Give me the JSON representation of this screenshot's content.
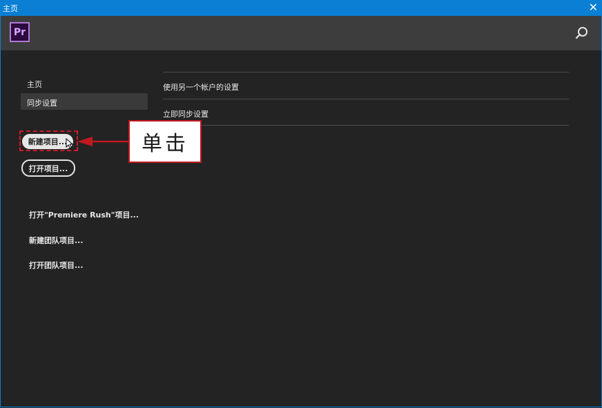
{
  "window": {
    "title": "主页",
    "close_symbol": "✕"
  },
  "header": {
    "logo_text": "Pr",
    "search_icon": "search-icon"
  },
  "sidebar": {
    "home_label": "主页",
    "sync_label": "同步设置"
  },
  "buttons": {
    "new_project": "新建项目...",
    "open_project": "打开项目..."
  },
  "links": {
    "open_rush": "打开\"Premiere Rush\"项目...",
    "new_team": "新建团队项目...",
    "open_team": "打开团队项目..."
  },
  "sync_panel": {
    "use_other_account": "使用另一个帐户的设置",
    "sync_now": "立即同步设置"
  },
  "annotation": {
    "callout_text": "单击"
  },
  "colors": {
    "titlebar": "#0a7fd4",
    "header": "#3d3d3d",
    "background": "#232323",
    "annotation_red": "#c2181f",
    "logo_purple": "#b07ad6"
  }
}
